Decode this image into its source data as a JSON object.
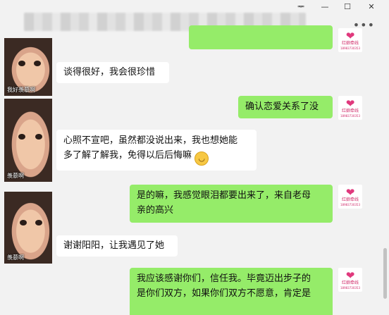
{
  "window": {
    "pin_label": "ᆓ",
    "minimize_label": "—",
    "maximize_label": "☐",
    "close_label": "✕",
    "more_label": "•••"
  },
  "messages": [
    {
      "side": "left",
      "text": "谈得很好，我会很珍惜"
    },
    {
      "side": "right",
      "text": "确认恋爱关系了没"
    },
    {
      "side": "left",
      "line1": "心照不宣吧，虽然都没说出来，我也想她能",
      "line2": "多了解了解我，免得以后后悔嘛",
      "emoji": "😄"
    },
    {
      "side": "right",
      "line1": "是的嘛，我感觉眼泪都要出来了，来自老母",
      "line2": "亲的高兴"
    },
    {
      "side": "left",
      "text": "谢谢阳阳，让我遇见了她"
    },
    {
      "side": "right",
      "line1": "我应该感谢你们，信任我。毕竟迈出步子的",
      "line2": "是你们双方，如果你们双方不愿意，肯定是"
    }
  ],
  "avatars": {
    "left_caption": "我好羡慕啊",
    "left_caption2": "羡慕啊",
    "right_brand": "红娘牵线",
    "right_phone": "18983730353"
  },
  "colors": {
    "right_bubble": "#95ec69",
    "left_bubble": "#ffffff",
    "background": "#f2f2f2"
  }
}
